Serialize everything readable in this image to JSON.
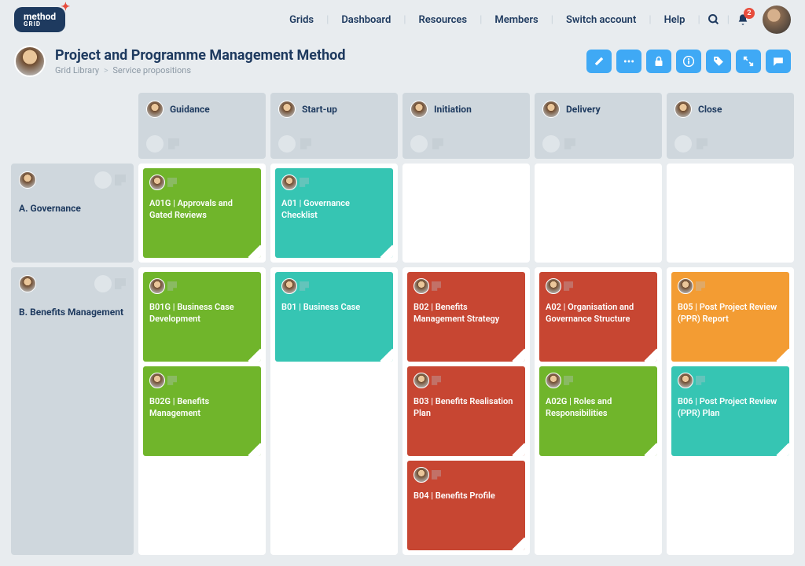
{
  "logo": {
    "name": "method",
    "sub": "GRID"
  },
  "nav": {
    "grids": "Grids",
    "dashboard": "Dashboard",
    "resources": "Resources",
    "members": "Members",
    "switch": "Switch account",
    "help": "Help",
    "notif_count": "2"
  },
  "breadcrumb": {
    "a": "Grid Library",
    "b": "Service propositions"
  },
  "title": "Project and Programme Management Method",
  "columns": {
    "c0": "Guidance",
    "c1": "Start-up",
    "c2": "Initiation",
    "c3": "Delivery",
    "c4": "Close"
  },
  "rows": {
    "r0": "A. Governance",
    "r1": "B. Benefits Management"
  },
  "cards": {
    "a01g": "A01G | Approvals and Gated Reviews",
    "a01": "A01 | Governance Checklist",
    "b01g": "B01G | Business Case Development",
    "b02g": "B02G | Benefits Management",
    "b01": "B01 | Business Case",
    "b02": "B02 | Benefits Management Strategy",
    "b03": "B03 | Benefits Realisation Plan",
    "b04": "B04 | Benefits Profile",
    "a02": "A02 | Organisation and Governance Structure",
    "a02g": "A02G | Roles and Responsibilities",
    "b05": "B05 | Post Project Review (PPR) Report",
    "b06": "B06 | Post Project Review (PPR) Plan"
  }
}
